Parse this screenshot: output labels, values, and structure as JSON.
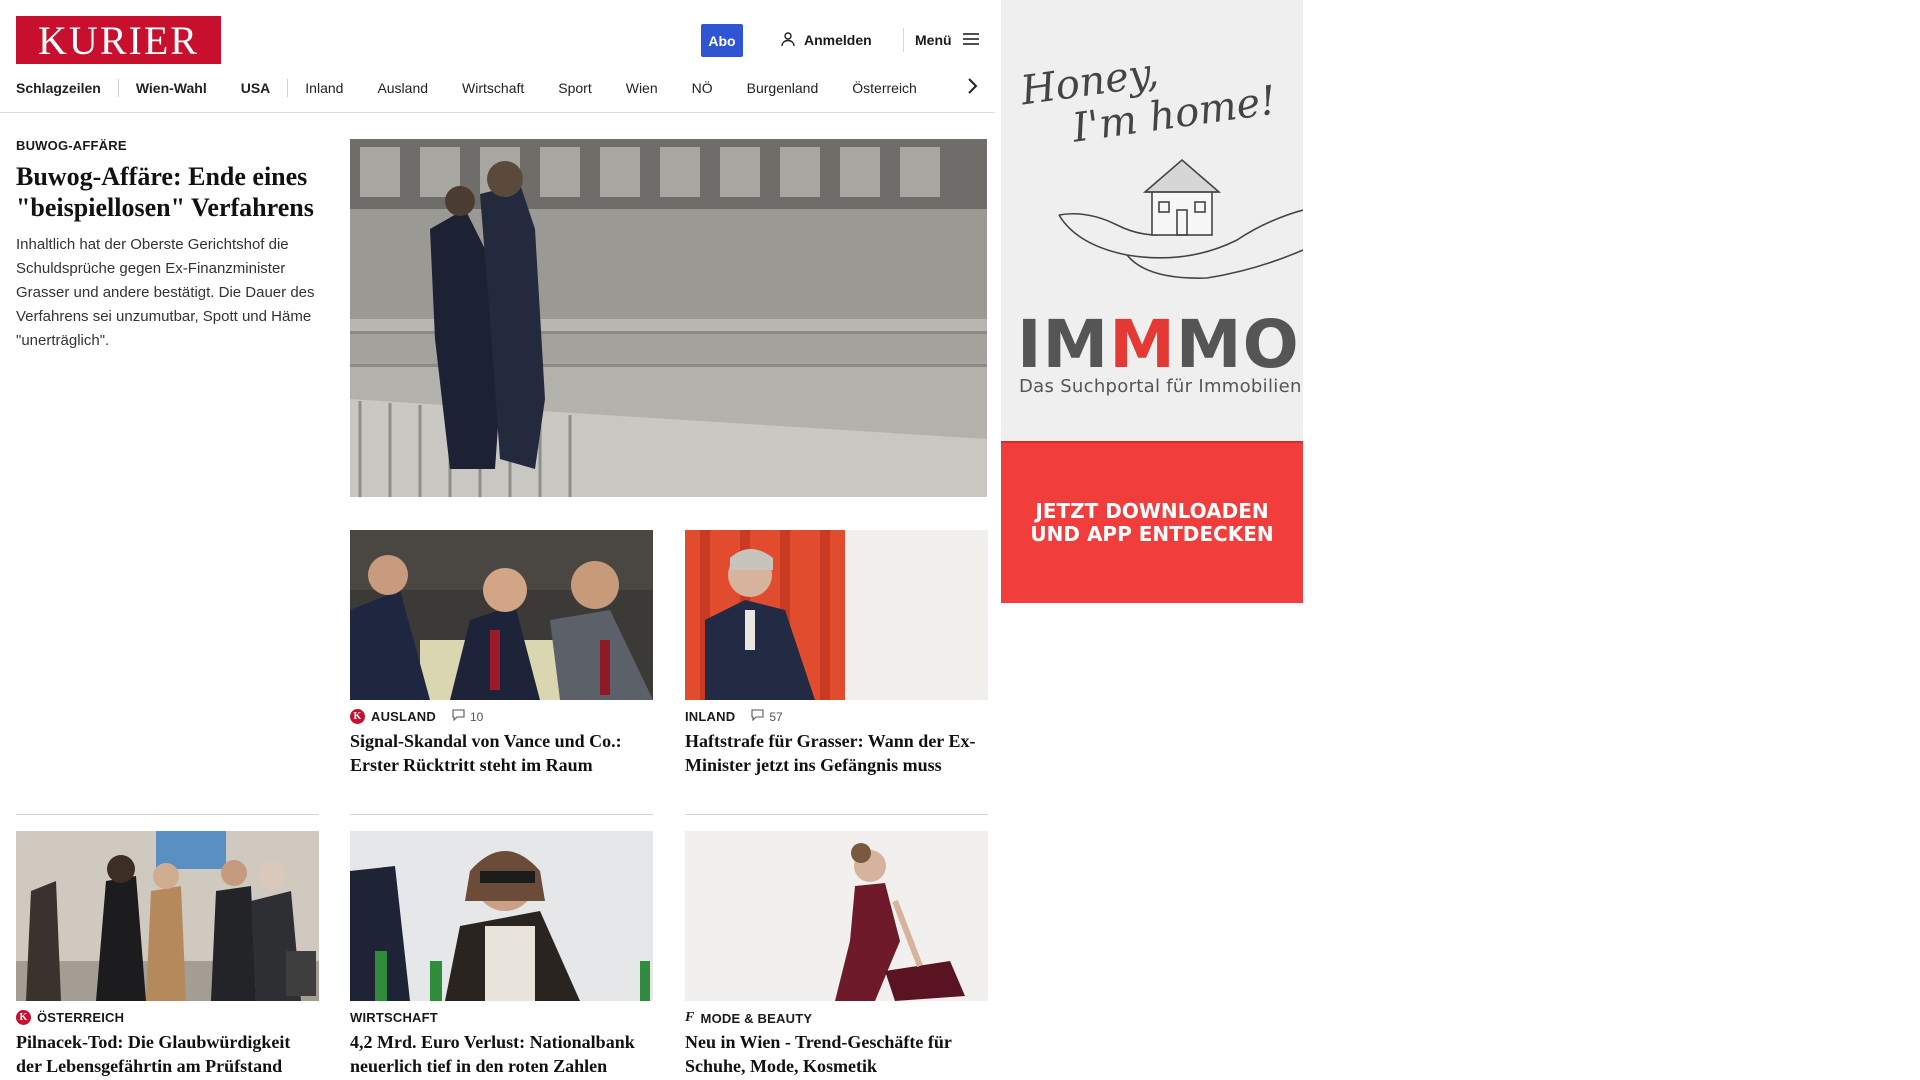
{
  "header": {
    "logo_text": "KURIER",
    "abo_label": "Abo",
    "login_label": "Anmelden",
    "menu_label": "Menü",
    "accent_color": "#c8102e",
    "abo_color": "#2f55d4"
  },
  "nav": {
    "items": [
      {
        "label": "Schlagzeilen",
        "bold": true
      },
      {
        "label": "Wien-Wahl",
        "bold": true
      },
      {
        "label": "USA",
        "bold": true
      },
      {
        "label": "Inland",
        "bold": false
      },
      {
        "label": "Ausland",
        "bold": false
      },
      {
        "label": "Wirtschaft",
        "bold": false
      },
      {
        "label": "Sport",
        "bold": false
      },
      {
        "label": "Wien",
        "bold": false
      },
      {
        "label": "NÖ",
        "bold": false
      },
      {
        "label": "Burgenland",
        "bold": false
      },
      {
        "label": "Österreich",
        "bold": false
      }
    ],
    "next_icon": "chevron-right-icon"
  },
  "lead": {
    "kicker": "Buwog-Affäre",
    "title": "Buwog-Affäre: Ende eines \"beispiellosen\" Verfahrens",
    "teaser": "Inhaltlich hat der Oberste Gerichtshof die Schuldsprüche gegen Ex-Finanzminister Grasser und andere bestätigt. Die Dauer des Verfahrens sei unzumutbar, Spott und Häme \"unerträglich\"."
  },
  "cards": [
    {
      "kicker": "Ausland",
      "badge": "K",
      "comments": "10",
      "title": "Signal-Skandal von Vance und Co.: Erster Rücktritt steht im Raum"
    },
    {
      "kicker": "Inland",
      "badge": "",
      "comments": "57",
      "title": "Haftstrafe für Grasser: Wann der Ex-Minister jetzt ins Gefängnis muss"
    },
    {
      "kicker": "Österreich",
      "badge": "K",
      "comments": "",
      "title": "Pilnacek-Tod: Die Glaubwürdigkeit der Lebensgefährtin am Prüfstand"
    },
    {
      "kicker": "Wirtschaft",
      "badge": "",
      "comments": "",
      "title": "4,2 Mrd. Euro Verlust: Nationalbank neuerlich tief in den roten Zahlen"
    },
    {
      "kicker": "Mode & Beauty",
      "badge": "f",
      "comments": "",
      "title": "Neu in Wien - Trend-Geschäfte für Schuhe, Mode, Kosmetik"
    }
  ],
  "ad": {
    "script_line1": "Honey,",
    "script_line2": "I'm home!",
    "brand_part1": "IM",
    "brand_part2": "M",
    "brand_part3": "MO",
    "subline": "Das Suchportal für Immobilien",
    "cta_line1": "JETZT DOWNLOADEN",
    "cta_line2": "UND APP ENTDECKEN",
    "brand_color": "#e53935",
    "cta_color": "#f23d3d"
  }
}
